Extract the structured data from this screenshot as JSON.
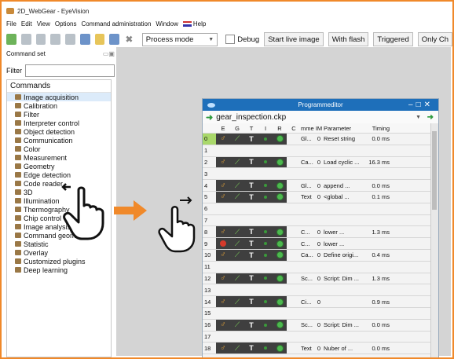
{
  "window": {
    "title": "2D_WebGear - EyeVision"
  },
  "menu": [
    {
      "label": "File"
    },
    {
      "label": "Edit"
    },
    {
      "label": "View"
    },
    {
      "label": "Options"
    },
    {
      "label": "Command administration"
    },
    {
      "label": "Window"
    },
    {
      "label": "Help"
    }
  ],
  "toolbar": {
    "mode_value": "Process mode",
    "debug_label": "Debug",
    "buttons": [
      "Start live image",
      "With flash",
      "Triggered",
      "Only Ch"
    ]
  },
  "command_set": {
    "panel_title": "Command set",
    "filter_label": "Filter",
    "list_header": "Commands",
    "items": [
      "Image acquisition",
      "Calibration",
      "Filter",
      "Interpreter control",
      "Object detection",
      "Communication",
      "Color",
      "Measurement",
      "Geometry",
      "Edge detection",
      "Code reader",
      "3D",
      "Illumination",
      "Thermography",
      "Chip control",
      "Image analysis",
      "Command geometry",
      "Statistic",
      "Overlay",
      "Customized plugins",
      "Deep learning"
    ],
    "selected_index": 0
  },
  "editor": {
    "title": "Programmeditor",
    "file_name": "gear_inspection.ckp",
    "columns": [
      "E",
      "G",
      "T",
      "I",
      "R",
      "C",
      "mme",
      "IM",
      "Parameter",
      "Timing"
    ],
    "rows": [
      {
        "n": "0",
        "filled": true,
        "cmd": "Gl...",
        "im": "0",
        "param": "Reset string",
        "timing": "0.0 ms",
        "icon": "gl"
      },
      {
        "n": "1",
        "filled": false
      },
      {
        "n": "2",
        "filled": true,
        "cmd": "Ca...",
        "im": "0",
        "param": "Load cyclic ...",
        "timing": "16.3 ms",
        "icon": "ca"
      },
      {
        "n": "3",
        "filled": false
      },
      {
        "n": "4",
        "filled": true,
        "cmd": "Gl...",
        "im": "0",
        "param": "append ...",
        "timing": "0.0 ms",
        "icon": "gl"
      },
      {
        "n": "5",
        "filled": true,
        "cmd": "Text",
        "im": "0",
        "param": "<global ...",
        "timing": "0.1 ms",
        "icon": "tx"
      },
      {
        "n": "6",
        "filled": false
      },
      {
        "n": "7",
        "filled": false
      },
      {
        "n": "8",
        "filled": true,
        "cmd": "C...",
        "im": "0",
        "param": "lower ...",
        "timing": "1.3 ms",
        "icon": "c"
      },
      {
        "n": "9",
        "filled": true,
        "stop": true,
        "cmd": "C...",
        "im": "0",
        "param": "lower ...",
        "timing": "",
        "icon": "c"
      },
      {
        "n": "10",
        "filled": true,
        "cmd": "Ca...",
        "im": "0",
        "param": "Define origi...",
        "timing": "0.4 ms",
        "icon": "c"
      },
      {
        "n": "11",
        "filled": false
      },
      {
        "n": "12",
        "filled": true,
        "cmd": "Sc...",
        "im": "0",
        "param": "Script: Dim ...",
        "timing": "1.3 ms",
        "icon": "sc"
      },
      {
        "n": "13",
        "filled": false
      },
      {
        "n": "14",
        "filled": true,
        "cmd": "Ci...",
        "im": "0",
        "param": "",
        "timing": "0.9 ms",
        "icon": "ci"
      },
      {
        "n": "15",
        "filled": false
      },
      {
        "n": "16",
        "filled": true,
        "cmd": "Sc...",
        "im": "0",
        "param": "Script: Dim ...",
        "timing": "0.0 ms",
        "icon": "sc"
      },
      {
        "n": "17",
        "filled": false
      },
      {
        "n": "18",
        "filled": true,
        "cmd": "Text",
        "im": "0",
        "param": "Nuber of ...",
        "timing": "0.0 ms",
        "icon": "tx"
      }
    ]
  },
  "colors": {
    "accent_border": "#f0892a",
    "title_bar": "#1e6fba",
    "arrow": "#f0892a"
  },
  "icons": {
    "hand_drag": "hand-pointer-icon",
    "hand_drop": "hand-pointer-outline-icon"
  }
}
